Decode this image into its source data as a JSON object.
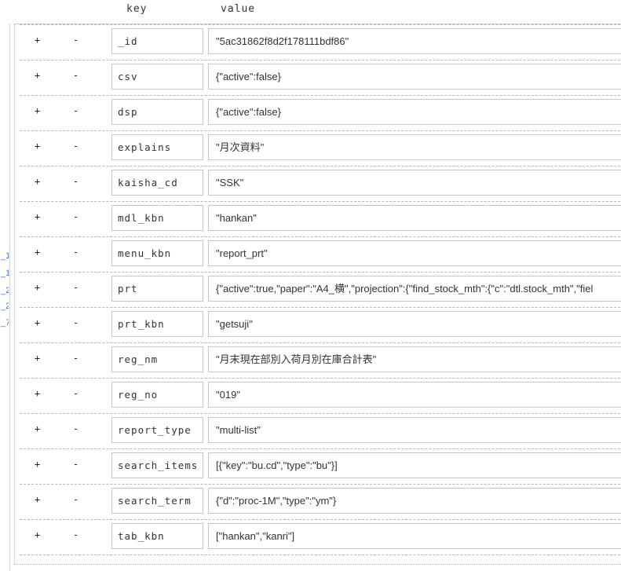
{
  "header": {
    "key_label": "key",
    "value_label": "value"
  },
  "edge_marks": [
    "_1",
    "_1",
    "_2",
    "_2",
    "_7"
  ],
  "rows": [
    {
      "plus": "+",
      "minus": "-",
      "key": "_id",
      "value": "\"5ac31862f8d2f178111bdf86\""
    },
    {
      "plus": "+",
      "minus": "-",
      "key": "csv",
      "value": "{\"active\":false}"
    },
    {
      "plus": "+",
      "minus": "-",
      "key": "dsp",
      "value": "{\"active\":false}"
    },
    {
      "plus": "+",
      "minus": "-",
      "key": "explains",
      "value": "\"月次資料\""
    },
    {
      "plus": "+",
      "minus": "-",
      "key": "kaisha_cd",
      "value": "\"SSK\""
    },
    {
      "plus": "+",
      "minus": "-",
      "key": "mdl_kbn",
      "value": "\"hankan\""
    },
    {
      "plus": "+",
      "minus": "-",
      "key": "menu_kbn",
      "value": "\"report_prt\""
    },
    {
      "plus": "+",
      "minus": "-",
      "key": "prt",
      "value": "{\"active\":true,\"paper\":\"A4_横\",\"projection\":{\"find_stock_mth\":{\"c\":\"dtl.stock_mth\",\"fiel"
    },
    {
      "plus": "+",
      "minus": "-",
      "key": "prt_kbn",
      "value": "\"getsuji\""
    },
    {
      "plus": "+",
      "minus": "-",
      "key": "reg_nm",
      "value": "\"月末現在部別入荷月別在庫合計表\""
    },
    {
      "plus": "+",
      "minus": "-",
      "key": "reg_no",
      "value": "\"019\""
    },
    {
      "plus": "+",
      "minus": "-",
      "key": "report_type",
      "value": "\"multi-list\""
    },
    {
      "plus": "+",
      "minus": "-",
      "key": "search_items",
      "value": "[{\"key\":\"bu.cd\",\"type\":\"bu\"}]"
    },
    {
      "plus": "+",
      "minus": "-",
      "key": "search_term",
      "value": "{\"d\":\"proc-1M\",\"type\":\"ym\"}"
    },
    {
      "plus": "+",
      "minus": "-",
      "key": "tab_kbn",
      "value": "[\"hankan\",\"kanri\"]"
    }
  ]
}
